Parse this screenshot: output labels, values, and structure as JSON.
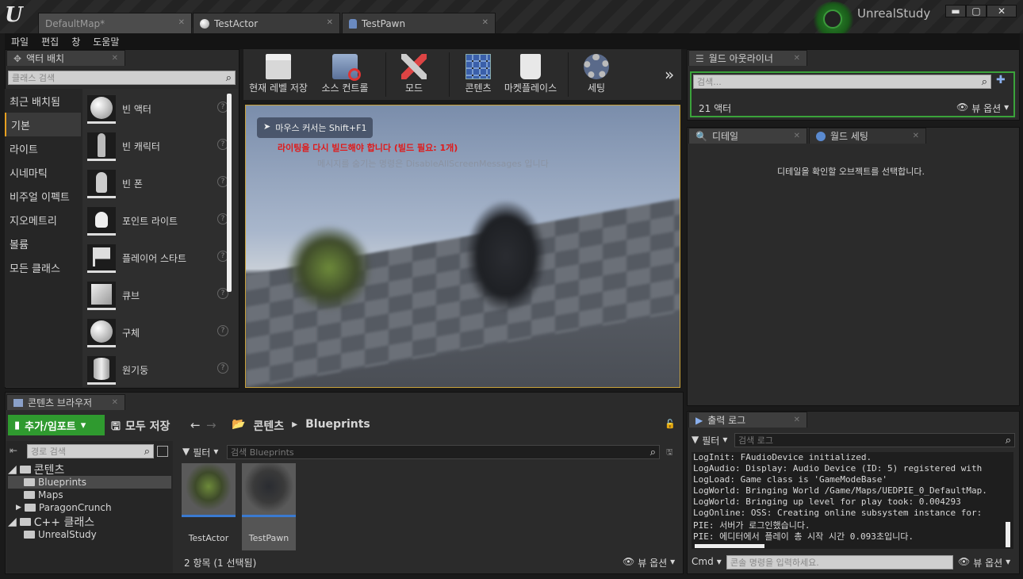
{
  "app": {
    "title": "UnrealStudy",
    "logo": "unreal-logo"
  },
  "tabs": [
    {
      "label": "DefaultMap*",
      "active": true
    },
    {
      "label": "TestActor",
      "active": false
    },
    {
      "label": "TestPawn",
      "active": false
    }
  ],
  "window_controls": {
    "minimize": "▬",
    "maximize": "▢",
    "close": "✕"
  },
  "menu": [
    "파일",
    "편집",
    "창",
    "도움말"
  ],
  "place_actors": {
    "tab_label": "액터 배치",
    "search_placeholder": "클래스 검색",
    "categories": [
      "최근 배치됨",
      "기본",
      "라이트",
      "시네마틱",
      "비주얼 이펙트",
      "지오메트리",
      "볼륨",
      "모든 클래스"
    ],
    "selected_category": "기본",
    "items": [
      "빈 액터",
      "빈 캐릭터",
      "빈 폰",
      "포인트 라이트",
      "플레이어 스타트",
      "큐브",
      "구체",
      "원기둥"
    ],
    "help_glyph": "?"
  },
  "toolbar": {
    "items": [
      "현재 레벨 저장",
      "소스 컨트롤",
      "모드",
      "콘텐츠",
      "마켓플레이스",
      "세팅"
    ],
    "overflow": "»"
  },
  "viewport": {
    "hint": "마우스 커서는 Shift+F1",
    "warning": "라이팅을 다시 빌드해야 합니다 (빌드 필요: 1개)",
    "info": "메시지를 숨기는 명령은 DisableAllScreenMessages 입니다"
  },
  "world_outliner": {
    "tab_label": "월드 아웃라이너",
    "search_placeholder": "검색...",
    "count": "21 액터",
    "view_options": "뷰 옵션"
  },
  "details": {
    "tab_label": "디테일",
    "world_settings_tab": "월드 세팅",
    "empty_message": "디테일을 확인할 오브젝트를 선택합니다."
  },
  "content_browser": {
    "tab_label": "콘텐츠 브라우저",
    "add_import": "추가/임포트",
    "save_all": "모두 저장",
    "breadcrumb": [
      "콘텐츠",
      "Blueprints"
    ],
    "path_search_placeholder": "경로 검색",
    "filter_label": "필터",
    "asset_search_placeholder": "검색 Blueprints",
    "tree": [
      {
        "label": "콘텐츠",
        "level": 0,
        "kind": "folder-root"
      },
      {
        "label": "Blueprints",
        "level": 1,
        "kind": "folder",
        "selected": true
      },
      {
        "label": "Maps",
        "level": 1,
        "kind": "folder"
      },
      {
        "label": "ParagonCrunch",
        "level": 1,
        "kind": "folder"
      },
      {
        "label": "C++ 클래스",
        "level": 0,
        "kind": "cpp-root"
      },
      {
        "label": "UnrealStudy",
        "level": 1,
        "kind": "cpp"
      }
    ],
    "assets": [
      {
        "label": "TestActor",
        "selected": false
      },
      {
        "label": "TestPawn",
        "selected": true
      }
    ],
    "status": "2 항목 (1 선택됨)",
    "view_options": "뷰 옵션"
  },
  "output_log": {
    "tab_label": "출력 로그",
    "filter_label": "필터",
    "search_placeholder": "검색 로그",
    "lines": [
      "LogInit: FAudioDevice initialized.",
      "LogAudio: Display: Audio Device (ID: 5) registered with",
      "LogLoad: Game class is 'GameModeBase'",
      "LogWorld: Bringing World /Game/Maps/UEDPIE_0_DefaultMap.",
      "LogWorld: Bringing up level for play took: 0.004293",
      "LogOnline: OSS: Creating online subsystem instance for:",
      "PIE: 서버가 로그인했습니다.",
      "PIE: 에디터에서 플레이 총 시작 시간 0.093초입니다."
    ],
    "cmd_label": "Cmd",
    "cmd_placeholder": "콘솔 명령을 입력하세요.",
    "view_options": "뷰 옵션"
  }
}
